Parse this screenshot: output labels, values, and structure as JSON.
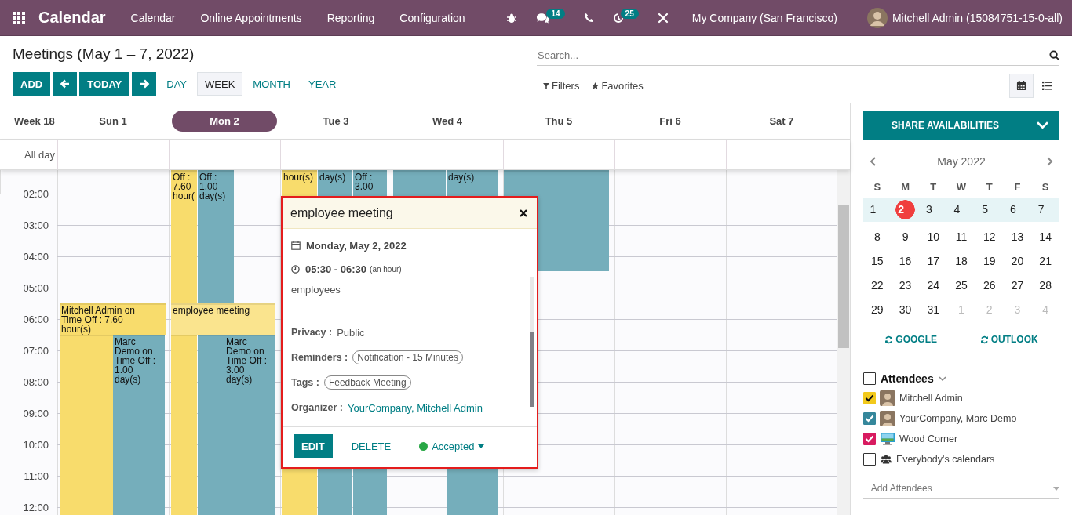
{
  "topbar": {
    "app_title": "Calendar",
    "menu": [
      "Calendar",
      "Online Appointments",
      "Reporting",
      "Configuration"
    ],
    "chat_badge": "14",
    "activity_badge": "25",
    "company": "My Company (San Francisco)",
    "user": "Mitchell Admin (15084751-15-0-all)"
  },
  "control_panel": {
    "title": "Meetings (May 1 – 7, 2022)",
    "add": "ADD",
    "today": "TODAY",
    "scales": [
      {
        "label": "DAY",
        "selected": false
      },
      {
        "label": "WEEK",
        "selected": true
      },
      {
        "label": "MONTH",
        "selected": false
      },
      {
        "label": "YEAR",
        "selected": false
      }
    ],
    "search": {
      "placeholder": "Search..."
    },
    "filters": "Filters",
    "favorites": "Favorites",
    "views": [
      {
        "kind": "calendar",
        "selected": true
      },
      {
        "kind": "list",
        "selected": false
      }
    ]
  },
  "week": {
    "label": "Week 18",
    "days": [
      {
        "label": "Sun 1",
        "selected": false
      },
      {
        "label": "Mon 2",
        "selected": true
      },
      {
        "label": "Tue 3",
        "selected": false
      },
      {
        "label": "Wed 4",
        "selected": false
      },
      {
        "label": "Thu 5",
        "selected": false
      },
      {
        "label": "Fri 6",
        "selected": false
      },
      {
        "label": "Sat 7",
        "selected": false
      }
    ],
    "all_day": "All day",
    "hours": [
      "02:00",
      "03:00",
      "04:00",
      "05:00",
      "06:00",
      "07:00",
      "08:00",
      "09:00",
      "10:00",
      "11:00",
      "12:00"
    ]
  },
  "events": [
    {
      "title": "Off : 7.60 hour(",
      "color": "#f8dc6c"
    },
    {
      "color": "#f8dc6c"
    },
    {
      "title": "Off : 1.00 day(s)",
      "color": "#75aebb"
    },
    {
      "title": "hour(s)",
      "color": "#f8dc6c"
    },
    {
      "title": "day(s)",
      "color": "#75aebb"
    },
    {
      "title": "Off : 3.00",
      "color": "#75aebb"
    },
    {
      "color": "#75aebb"
    },
    {
      "title": "day(s)",
      "color": "#75aebb"
    },
    {
      "color": "#75aebb"
    },
    {
      "title": "Mitchell Admin on Time Off : 7.60 hour(s)",
      "color": "#f8dc6c"
    },
    {
      "color": "#f8dc6c"
    },
    {
      "title": "Marc Demo on Time Off : 1.00 day(s)",
      "color": "#75aebb"
    },
    {
      "color": "#75aebb"
    },
    {
      "title": "employee meeting",
      "color": "#fae48e"
    },
    {
      "title": "Marc Demo on Time Off : 3.00 day(s)",
      "color": "#75aebb"
    }
  ],
  "popover": {
    "title": "employee meeting",
    "date": "Monday, May 2, 2022",
    "time": "05:30 - 06:30",
    "duration": "(an hour)",
    "description": "employees",
    "fields": [
      {
        "label": "Privacy :",
        "value": "Public",
        "kind": "text"
      },
      {
        "label": "Reminders :",
        "value": "Notification - 15 Minutes",
        "kind": "tag"
      },
      {
        "label": "Tags :",
        "value": "Feedback Meeting",
        "kind": "tag"
      },
      {
        "label": "Organizer :",
        "value": "YourCompany, Mitchell Admin",
        "kind": "link"
      }
    ],
    "edit": "EDIT",
    "delete": "DELETE",
    "status": "Accepted"
  },
  "sidebar": {
    "share": "SHARE AVAILABILITIES",
    "month": "May 2022",
    "weekdays": [
      "S",
      "M",
      "T",
      "W",
      "T",
      "F",
      "S"
    ],
    "weeks": [
      {
        "highlighted": true,
        "days": [
          {
            "day": "1",
            "muted": false,
            "selected": false
          },
          {
            "day": "2",
            "muted": false,
            "selected": true
          },
          {
            "day": "3",
            "muted": false,
            "selected": false
          },
          {
            "day": "4",
            "muted": false,
            "selected": false
          },
          {
            "day": "5",
            "muted": false,
            "selected": false
          },
          {
            "day": "6",
            "muted": false,
            "selected": false
          },
          {
            "day": "7",
            "muted": false,
            "selected": false
          }
        ]
      },
      {
        "highlighted": false,
        "days": [
          {
            "day": "8",
            "muted": false,
            "selected": false
          },
          {
            "day": "9",
            "muted": false,
            "selected": false
          },
          {
            "day": "10",
            "muted": false,
            "selected": false
          },
          {
            "day": "11",
            "muted": false,
            "selected": false
          },
          {
            "day": "12",
            "muted": false,
            "selected": false
          },
          {
            "day": "13",
            "muted": false,
            "selected": false
          },
          {
            "day": "14",
            "muted": false,
            "selected": false
          }
        ]
      },
      {
        "highlighted": false,
        "days": [
          {
            "day": "15",
            "muted": false,
            "selected": false
          },
          {
            "day": "16",
            "muted": false,
            "selected": false
          },
          {
            "day": "17",
            "muted": false,
            "selected": false
          },
          {
            "day": "18",
            "muted": false,
            "selected": false
          },
          {
            "day": "19",
            "muted": false,
            "selected": false
          },
          {
            "day": "20",
            "muted": false,
            "selected": false
          },
          {
            "day": "21",
            "muted": false,
            "selected": false
          }
        ]
      },
      {
        "highlighted": false,
        "days": [
          {
            "day": "22",
            "muted": false,
            "selected": false
          },
          {
            "day": "23",
            "muted": false,
            "selected": false
          },
          {
            "day": "24",
            "muted": false,
            "selected": false
          },
          {
            "day": "25",
            "muted": false,
            "selected": false
          },
          {
            "day": "26",
            "muted": false,
            "selected": false
          },
          {
            "day": "27",
            "muted": false,
            "selected": false
          },
          {
            "day": "28",
            "muted": false,
            "selected": false
          }
        ]
      },
      {
        "highlighted": false,
        "days": [
          {
            "day": "29",
            "muted": false,
            "selected": false
          },
          {
            "day": "30",
            "muted": false,
            "selected": false
          },
          {
            "day": "31",
            "muted": false,
            "selected": false
          },
          {
            "day": "1",
            "muted": true,
            "selected": false
          },
          {
            "day": "2",
            "muted": true,
            "selected": false
          },
          {
            "day": "3",
            "muted": true,
            "selected": false
          },
          {
            "day": "4",
            "muted": true,
            "selected": false
          }
        ]
      }
    ],
    "sync": [
      "GOOGLE",
      "OUTLOOK"
    ],
    "attendees_title": "Attendees",
    "attendees_checked": false,
    "attendees": [
      {
        "name": "Mitchell Admin",
        "checked": true,
        "color": "#f2c91c",
        "kind": "person"
      },
      {
        "name": "YourCompany, Marc Demo",
        "checked": true,
        "color": "#35879b",
        "kind": "person"
      },
      {
        "name": "Wood Corner",
        "checked": true,
        "color": "#d81b60",
        "kind": "company"
      },
      {
        "name": "Everybody's calendars",
        "checked": false,
        "kind": "group"
      }
    ],
    "add_placeholder": "+ Add Attendees"
  }
}
